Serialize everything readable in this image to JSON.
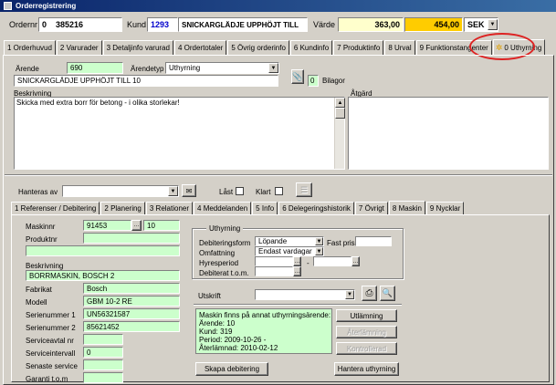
{
  "window": {
    "title": "Orderregistrering"
  },
  "header": {
    "ordernr_label": "Ordernr",
    "ordernr_prefix": "0",
    "ordernr_value": "385216",
    "kund_label": "Kund",
    "kund_value": "1293",
    "kund_name": "SNICKARGLÄDJE UPPHÖJT TILL",
    "varde_label": "Värde",
    "varde_value": "363,00",
    "total_value": "454,00",
    "currency": "SEK"
  },
  "main_tabs": [
    {
      "label": "1 Orderhuvud"
    },
    {
      "label": "2 Varurader"
    },
    {
      "label": "3 Detaljinfo varurad"
    },
    {
      "label": "4 Ordertotaler"
    },
    {
      "label": "5 Övrig orderinfo"
    },
    {
      "label": "6 Kundinfo"
    },
    {
      "label": "7 Produktinfo"
    },
    {
      "label": "8 Urval"
    },
    {
      "label": "9 Funktionstangenter"
    },
    {
      "label": "0 Uthyrning"
    }
  ],
  "arende": {
    "arende_label": "Ärende",
    "arende_value": "690",
    "arendetyp_label": "Ärendetyp",
    "arendetyp_value": "Uthyrning",
    "name_value": "SNICKARGLÄDJE UPPHÖJT TILL 10",
    "bilagor_count": "0",
    "bilagor_label": "Bilagor",
    "beskrivning_label": "Beskrivning",
    "beskrivning_text": "Skicka med extra borr för betong - i olika storlekar!",
    "atgard_label": "Åtgärd"
  },
  "handling": {
    "hanteras_av_label": "Hanteras av",
    "last_label": "Låst",
    "klart_label": "Klart"
  },
  "sub_tabs": [
    {
      "label": "1 Referenser / Debitering"
    },
    {
      "label": "2 Planering"
    },
    {
      "label": "3 Relationer"
    },
    {
      "label": "4 Meddelanden"
    },
    {
      "label": "5 Info"
    },
    {
      "label": "6 Delegeringshistorik"
    },
    {
      "label": "7 Övrigt"
    },
    {
      "label": "8 Maskin"
    },
    {
      "label": "9 Nycklar"
    }
  ],
  "maskin": {
    "maskinnr_label": "Maskinnr",
    "maskinnr_value": "91453",
    "maskinnr_extra": "10",
    "produktnr_label": "Produktnr",
    "produktnr_value": "",
    "produkt_desc": "",
    "beskrivning_label": "Beskrivning",
    "beskrivning_value": "BORRMASKIN, BOSCH 2",
    "rows": [
      {
        "label": "Fabrikat",
        "value": "Bosch"
      },
      {
        "label": "Modell",
        "value": "GBM 10-2 RE"
      },
      {
        "label": "Serienummer 1",
        "value": "UN56321587"
      },
      {
        "label": "Serienummer 2",
        "value": "85621452"
      },
      {
        "label": "Serviceavtal nr",
        "value": ""
      },
      {
        "label": "Serviceintervall",
        "value": "0"
      },
      {
        "label": "Senaste service",
        "value": ""
      },
      {
        "label": "Garanti t.o.m",
        "value": ""
      }
    ]
  },
  "uthyrning": {
    "group_label": "Uthyrning",
    "debiteringsform_label": "Debiteringsform",
    "debiteringsform_value": "Löpande",
    "fast_pris_label": "Fast pris",
    "omfattning_label": "Omfattning",
    "omfattning_value": "Endast vardagar",
    "hyresperiod_label": "Hyresperiod",
    "period_separator": "-",
    "debiterat_label": "Debiterat t.o.m.",
    "utskrift_label": "Utskrift",
    "info_text": "Maskin finns på annat uthyrningsärende:\nÄrende: 10\nKund: 319\nPeriod: 2009-10-26 -\nÅterlämnad: 2010-02-12",
    "btn_utlamning": "Utlämning",
    "btn_aterlamning": "Återlämning",
    "btn_kontrollerad": "Kontrollerad",
    "btn_skapa_debitering": "Skapa debitering",
    "btn_hantera_uthyrning": "Hantera uthyrning"
  },
  "colors": {
    "titlebar": "#0a246a",
    "green_field": "#ccffcc",
    "yellow_field": "#ffffcc",
    "orange_field": "#ffcc00",
    "highlight_ring": "#dd2222",
    "kund_blue": "#0000cc"
  }
}
